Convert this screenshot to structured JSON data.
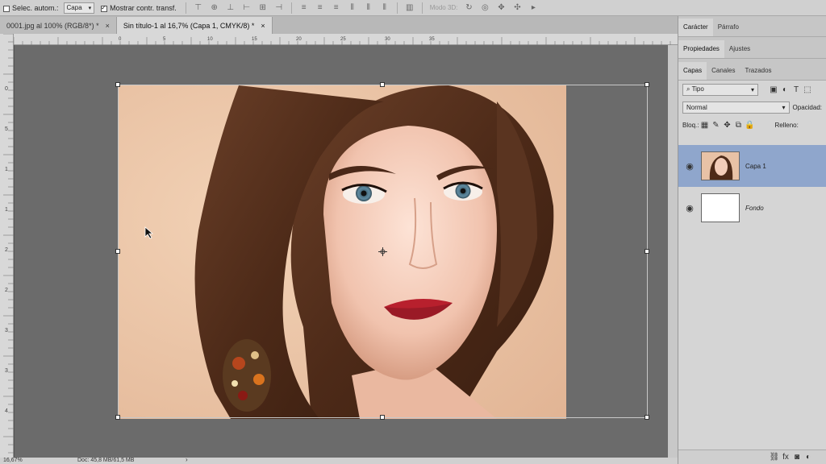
{
  "options_bar": {
    "auto_select_label": "Selec. autom.:",
    "auto_select_value": "Capa",
    "show_transform_label": "Mostrar contr. transf.",
    "mode_3d_label": "Modo 3D:"
  },
  "tabs": [
    {
      "label": "0001.jpg al 100% (RGB/8*) *",
      "close": "×"
    },
    {
      "label": "Sin título-1 al 16,7% (Capa 1, CMYK/8) *",
      "close": "×"
    }
  ],
  "rulers": {
    "horizontal": [
      "0",
      "5",
      "10",
      "15",
      "20",
      "25",
      "30",
      "35"
    ],
    "vertical": [
      "0",
      "5",
      "1",
      "1",
      "2",
      "2",
      "3",
      "3",
      "4"
    ]
  },
  "status": {
    "zoom": "16,67%",
    "doc": "Doc: 45,8 MB/61,5 MB"
  },
  "panels": {
    "row1": [
      "Carácter",
      "Párrafo"
    ],
    "row2": [
      "Propiedades",
      "Ajustes"
    ],
    "row3": [
      "Capas",
      "Canales",
      "Trazados"
    ],
    "filter_kind": "Tipo",
    "blend_mode": "Normal",
    "opacity_label": "Opacidad:",
    "lock_label": "Bloq.:",
    "fill_label": "Relleno:",
    "layers": [
      {
        "name": "Capa 1",
        "selected": true,
        "italic": false
      },
      {
        "name": "Fondo",
        "selected": false,
        "italic": true
      }
    ],
    "bottom_icons": [
      "link",
      "fx",
      "mask",
      "adjustment"
    ]
  },
  "colors": {
    "canvas_bg": "#6b6b6b",
    "panel_bg": "#d5d5d5",
    "selected_layer": "#8fa6cc"
  }
}
